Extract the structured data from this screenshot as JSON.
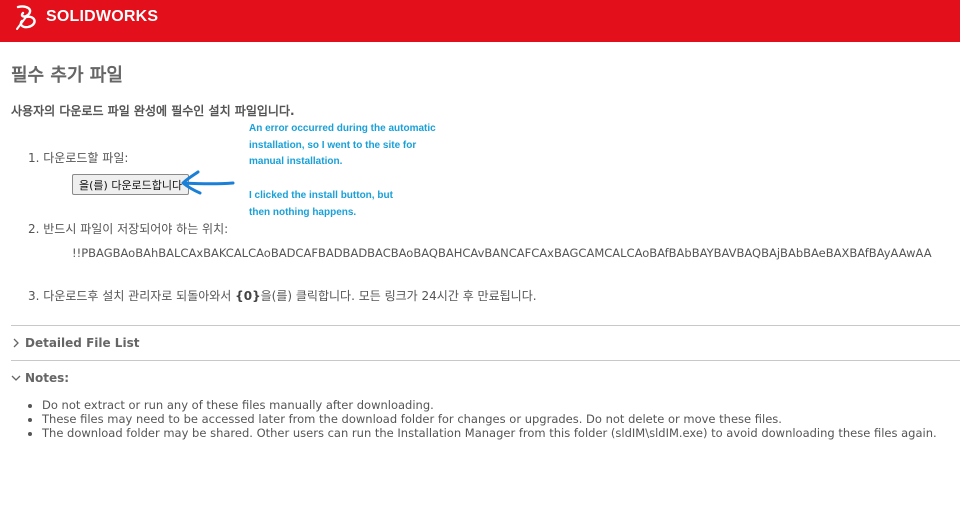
{
  "header": {
    "brand": "SOLIDWORKS",
    "bg_color": "#e30f1a"
  },
  "page": {
    "title": "필수 추가 파일",
    "subtitle": "사용자의 다운로드 파일 완성에 필수인 설치 파일입니다."
  },
  "steps": {
    "step1_label": "1. 다운로드할 파일:",
    "download_button": "을(를) 다운로드합니다",
    "step2_label": "2. 반드시 파일이 저장되어야 하는 위치:",
    "path": "!!PBAGBAoBAhBALCAxBAKCALCAoBADCAFBADBADBACBAoBAQBAHCAvBANCAFCAxBAGCAMCALCAoBAfBAbBAYBAVBAQBAjBAbBAeBAXBAfBAyAAwAA",
    "step3_prefix": "3. 다운로드후 설치 관리자로 되돌아와서 ",
    "step3_token": "{0}",
    "step3_suffix": "을(를) 클릭합니다. 모든 링크가 24시간 후 만료됩니다."
  },
  "annotations": {
    "note1": "An error occurred during the automatic\ninstallation, so I went to the site for\nmanual installation.",
    "note2": "I clicked the install button, but\nthen nothing happens.",
    "color": "#1aa0d8"
  },
  "sections": {
    "file_list_label": "Detailed File List",
    "notes_label": "Notes:"
  },
  "notes": [
    "Do not extract or run any of these files manually after downloading.",
    "These files may need to be accessed later from the download folder for changes or upgrades. Do not delete or move these files.",
    "The download folder may be shared. Other users can run the Installation Manager from this folder (sldIM\\sldIM.exe) to avoid downloading these files again."
  ],
  "icons": {
    "logo": "ds-logo-icon",
    "arrow": "hand-drawn-arrow-icon",
    "collapsed": "chevron-right-icon",
    "expanded": "chevron-down-icon"
  }
}
